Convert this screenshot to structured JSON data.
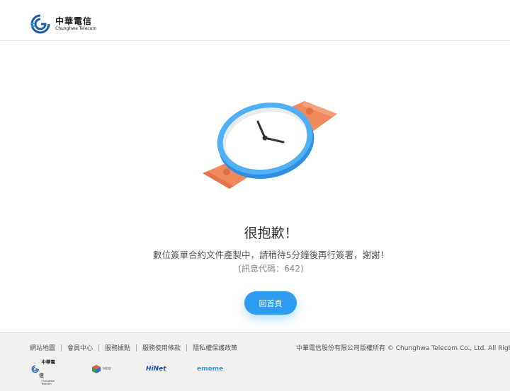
{
  "header": {
    "brand_zh": "中華電信",
    "brand_en": "Chunghwa Telecom"
  },
  "main": {
    "title": "很抱歉！",
    "message": "數位簽單合約文件產製中，請稍待5分鐘後再行簽署，謝謝！",
    "code": "(訊息代碼：642)",
    "home_button": "回首頁"
  },
  "footer": {
    "links": [
      {
        "label": "網站地圖"
      },
      {
        "label": "會員中心"
      },
      {
        "label": "服務據點"
      },
      {
        "label": "服務使用條款"
      },
      {
        "label": "隱私權保護政策"
      }
    ],
    "copyright": "中華電信股份有限公司版權所有 © Chunghwa Telecom Co., Ltd. All Rights Reserved.",
    "partners": {
      "cht_zh": "中華電信",
      "cht_en": "Chunghwa Telecom",
      "mod_text": "MOD",
      "hinet": "HiNet",
      "emome": "emome"
    }
  },
  "colors": {
    "accent": "#2d9cf0",
    "watch_blue": "#3aa0ef",
    "strap": "#f08a5d",
    "footer_bg": "#f0f0f0"
  },
  "icons": {
    "illustration": "watch-illustration",
    "logo": "chunghwa-logo-icon"
  }
}
